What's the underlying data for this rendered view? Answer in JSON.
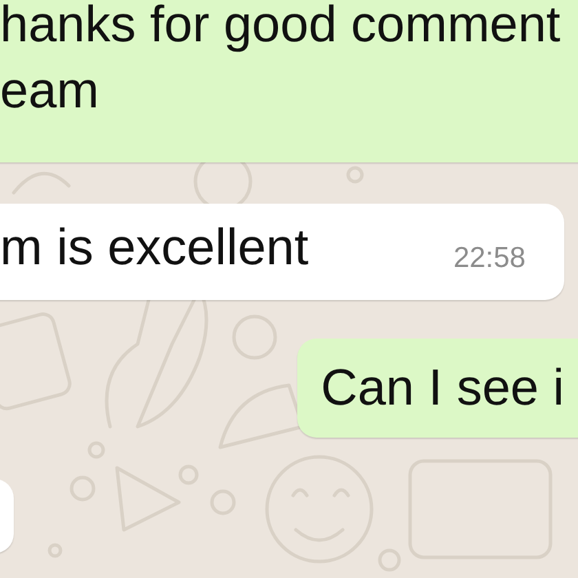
{
  "messages": [
    {
      "kind": "outgoing",
      "lines": [
        "hanks for good comment",
        "eam"
      ]
    },
    {
      "kind": "incoming",
      "lines": [
        "m is excellent"
      ],
      "time": "22:58"
    },
    {
      "kind": "outgoing",
      "lines": [
        "Can I see i"
      ]
    },
    {
      "kind": "incoming"
    }
  ]
}
